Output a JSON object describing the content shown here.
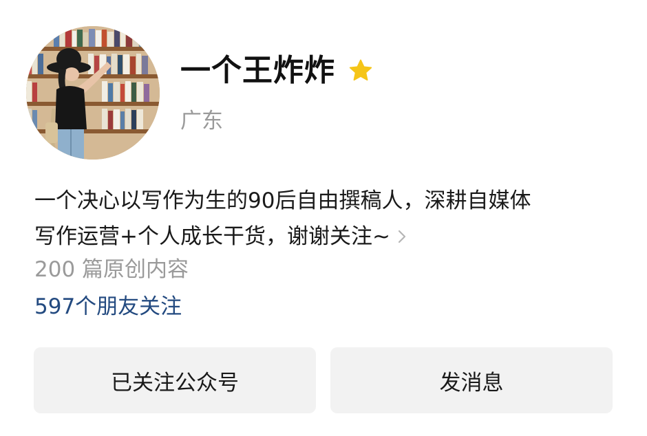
{
  "profile": {
    "name": "一个王炸炸",
    "location": "广东",
    "bio_line1": "一个决心以写作为生的90后自由撰稿人，深耕自媒体",
    "bio_line2": "写作运营+个人成长干货，谢谢关注~",
    "articles_count": "200 篇原创内容",
    "friends_following": "597个朋友关注"
  },
  "buttons": {
    "followed_label": "已关注公众号",
    "message_label": "发消息"
  },
  "colors": {
    "star": "#f5c518",
    "link_blue": "#234a80",
    "muted_gray": "#9a9a9a",
    "button_bg": "#f2f2f2"
  },
  "icons": {
    "avatar": "avatar-photo",
    "star": "star-icon",
    "chevron": "chevron-right-icon"
  }
}
